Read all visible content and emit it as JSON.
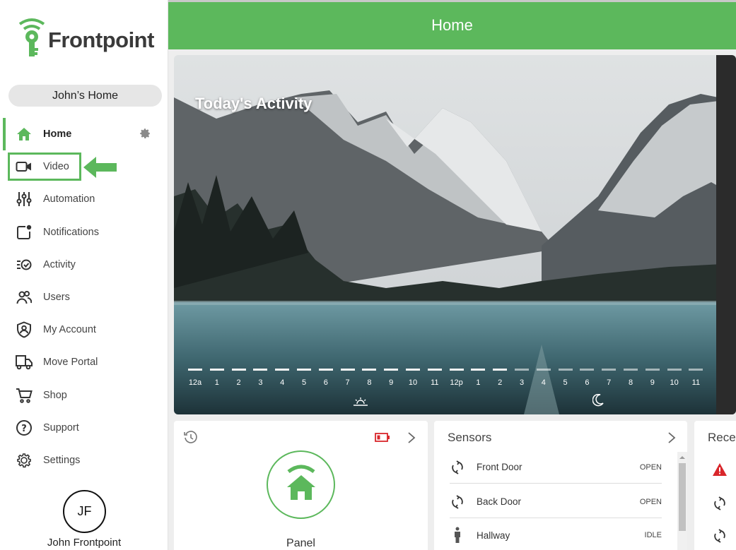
{
  "brand": {
    "name": "Frontpoint",
    "accent": "#5cb85c"
  },
  "home_selector": "John’s Home",
  "nav": [
    {
      "label": "Home",
      "icon": "house-icon",
      "active": true
    },
    {
      "label": "Video",
      "icon": "video-camera-icon"
    },
    {
      "label": "Automation",
      "icon": "sliders-icon"
    },
    {
      "label": "Notifications",
      "icon": "notification-square-icon"
    },
    {
      "label": "Activity",
      "icon": "activity-list-icon"
    },
    {
      "label": "Users",
      "icon": "users-icon"
    },
    {
      "label": "My Account",
      "icon": "shield-user-icon"
    },
    {
      "label": "Move Portal",
      "icon": "moving-truck-icon"
    },
    {
      "label": "Shop",
      "icon": "shopping-cart-icon"
    },
    {
      "label": "Support",
      "icon": "question-circle-icon"
    },
    {
      "label": "Settings",
      "icon": "gear-icon"
    }
  ],
  "user": {
    "initials": "JF",
    "name": "John Frontpoint"
  },
  "header": {
    "title": "Home"
  },
  "activity": {
    "title": "Today's Activity",
    "hours": [
      "12a",
      "1",
      "2",
      "3",
      "4",
      "5",
      "6",
      "7",
      "8",
      "9",
      "10",
      "11",
      "12p",
      "1",
      "2",
      "3",
      "4",
      "5",
      "6",
      "7",
      "8",
      "9",
      "10",
      "11"
    ],
    "elapsed_hours": 15
  },
  "panel_card": {
    "label": "Panel"
  },
  "sensors_card": {
    "title": "Sensors",
    "rows": [
      {
        "name": "Front Door",
        "status": "OPEN",
        "icon": "door-sensor-icon"
      },
      {
        "name": "Back Door",
        "status": "OPEN",
        "icon": "door-sensor-icon"
      },
      {
        "name": "Hallway",
        "status": "IDLE",
        "icon": "person-motion-icon"
      }
    ]
  },
  "recent_card": {
    "title": "Recen"
  }
}
